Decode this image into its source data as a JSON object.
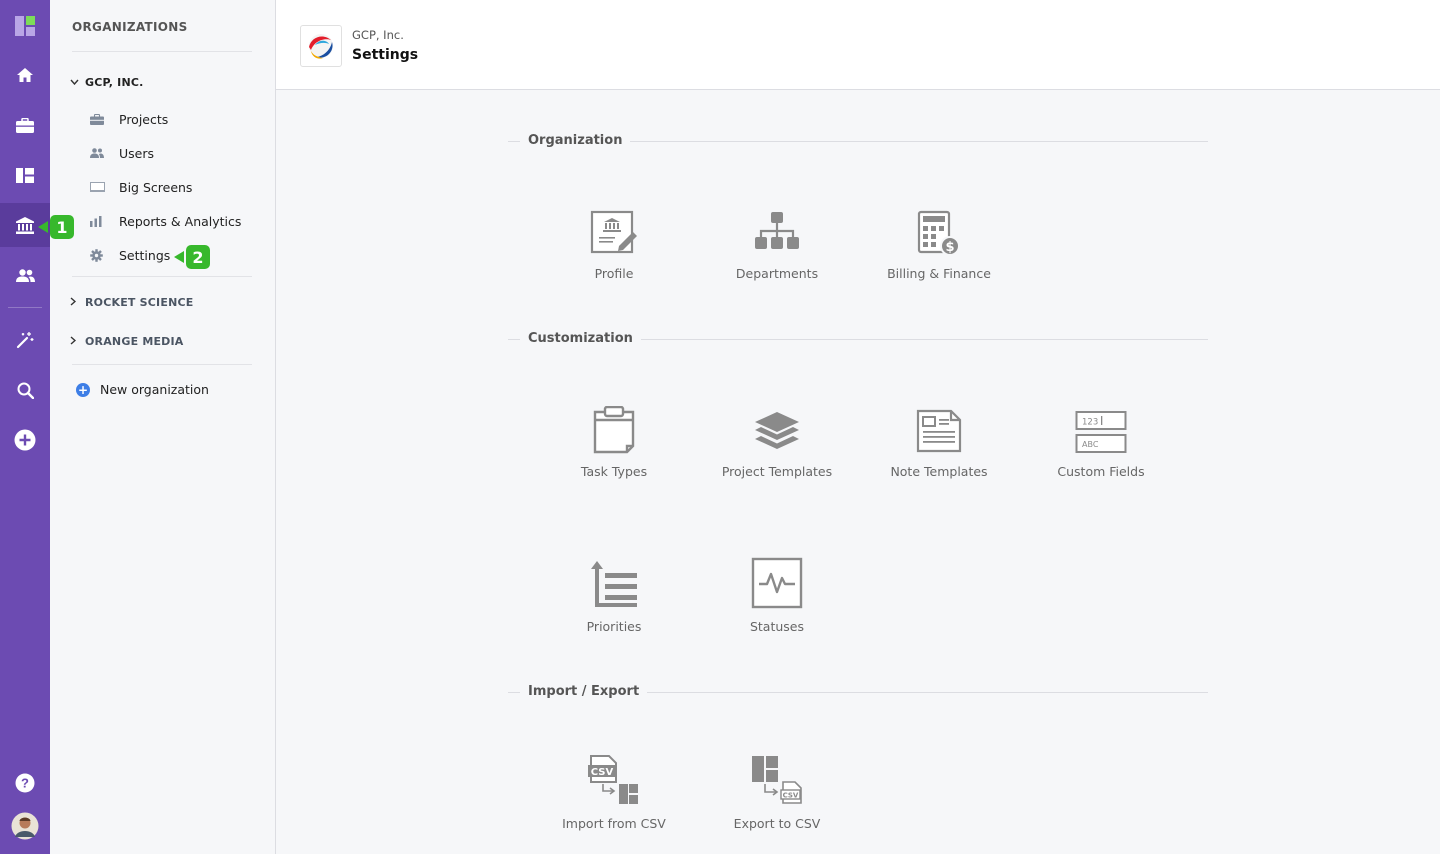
{
  "rail": {
    "items": [
      {
        "name": "logo",
        "icon": "app-logo-icon"
      },
      {
        "name": "home",
        "icon": "home-icon"
      },
      {
        "name": "projects",
        "icon": "briefcase-icon"
      },
      {
        "name": "boards",
        "icon": "board-icon"
      },
      {
        "name": "organizations",
        "icon": "bank-icon",
        "active": true
      },
      {
        "name": "people",
        "icon": "people-icon"
      },
      {
        "name": "magic",
        "icon": "magic-wand-icon"
      },
      {
        "name": "search",
        "icon": "search-icon"
      },
      {
        "name": "add",
        "icon": "plus-circle-icon"
      },
      {
        "name": "help",
        "icon": "help-icon"
      },
      {
        "name": "avatar",
        "icon": "avatar-icon"
      }
    ]
  },
  "sidebar": {
    "title": "ORGANIZATIONS",
    "orgs": [
      {
        "name": "GCP, INC.",
        "expanded": true
      },
      {
        "name": "ROCKET SCIENCE",
        "expanded": false
      },
      {
        "name": "ORANGE MEDIA",
        "expanded": false
      }
    ],
    "items": [
      {
        "label": "Projects",
        "icon": "briefcase-icon"
      },
      {
        "label": "Users",
        "icon": "users-icon"
      },
      {
        "label": "Big Screens",
        "icon": "screen-icon"
      },
      {
        "label": "Reports & Analytics",
        "icon": "bar-chart-icon"
      },
      {
        "label": "Settings",
        "icon": "gear-icon"
      }
    ],
    "new_org": "New organization"
  },
  "callouts": {
    "first": "1",
    "second": "2",
    "color": "#37b82c"
  },
  "header": {
    "org": "GCP, Inc.",
    "title": "Settings"
  },
  "sections": {
    "organization": {
      "label": "Organization",
      "tiles": [
        {
          "label": "Profile",
          "icon": "profile-edit-icon"
        },
        {
          "label": "Departments",
          "icon": "hierarchy-icon"
        },
        {
          "label": "Billing & Finance",
          "icon": "calculator-icon"
        }
      ]
    },
    "customization": {
      "label": "Customization",
      "tiles": [
        {
          "label": "Task Types",
          "icon": "clipboard-icon"
        },
        {
          "label": "Project Templates",
          "icon": "layers-icon"
        },
        {
          "label": "Note Templates",
          "icon": "note-icon"
        },
        {
          "label": "Custom Fields",
          "icon": "fields-icon"
        },
        {
          "label": "Priorities",
          "icon": "priorities-icon"
        },
        {
          "label": "Statuses",
          "icon": "pulse-icon"
        }
      ]
    },
    "import_export": {
      "label": "Import / Export",
      "tiles": [
        {
          "label": "Import from CSV",
          "icon": "csv-import-icon"
        },
        {
          "label": "Export to CSV",
          "icon": "csv-export-icon"
        }
      ]
    }
  },
  "colors": {
    "rail": "#6c4bb2",
    "icon_gray": "#8a8a8a",
    "accent_blue": "#3d7ee6"
  }
}
